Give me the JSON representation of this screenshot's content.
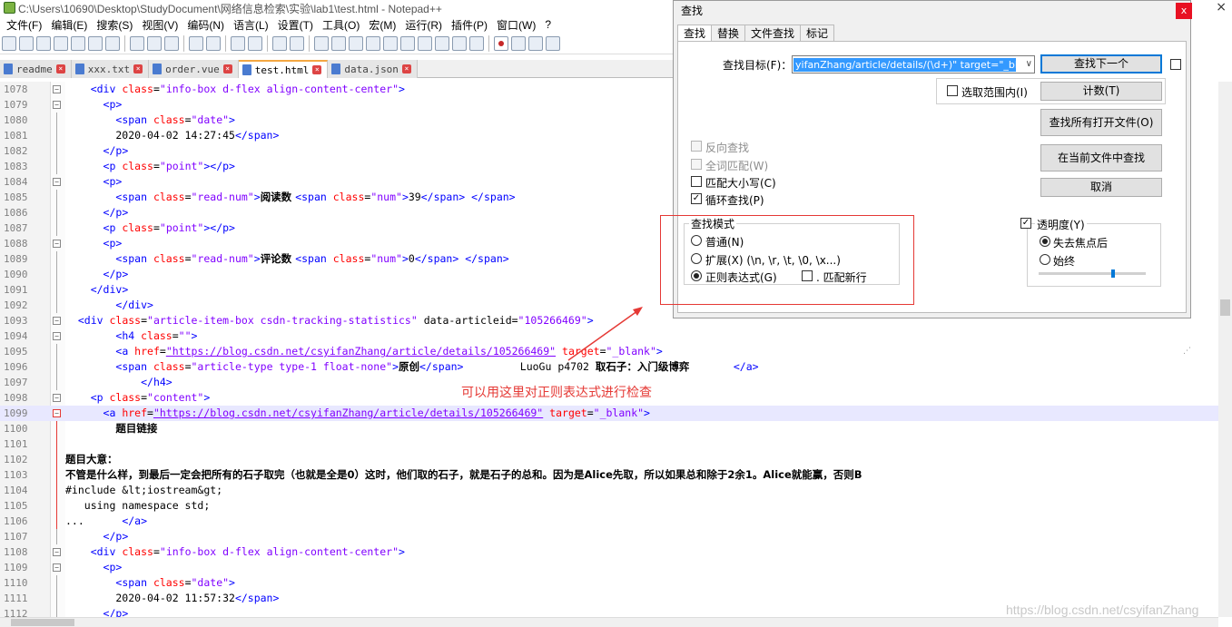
{
  "window": {
    "title": "C:\\Users\\10690\\Desktop\\StudyDocument\\网络信息检索\\实验\\lab1\\test.html - Notepad++",
    "close_glyph": "×"
  },
  "menu": [
    "文件(F)",
    "编辑(E)",
    "搜索(S)",
    "视图(V)",
    "编码(N)",
    "语言(L)",
    "设置(T)",
    "工具(O)",
    "宏(M)",
    "运行(R)",
    "插件(P)",
    "窗口(W)",
    "?"
  ],
  "tabs": [
    {
      "label": "readme",
      "active": false
    },
    {
      "label": "xxx.txt",
      "active": false
    },
    {
      "label": "order.vue",
      "active": false
    },
    {
      "label": "test.html",
      "active": true
    },
    {
      "label": "data.json",
      "active": false
    }
  ],
  "tab_close_glyph": "×",
  "editor": {
    "lines": [
      {
        "n": "1078",
        "fold": "minus",
        "segs": [
          [
            "p",
            "    "
          ],
          [
            "t",
            "<div "
          ],
          [
            "a",
            "class"
          ],
          [
            "p",
            "="
          ],
          [
            "v",
            "\"info-box d-flex align-content-center\""
          ],
          [
            "t",
            ">"
          ]
        ]
      },
      {
        "n": "1079",
        "fold": "minus",
        "segs": [
          [
            "p",
            "      "
          ],
          [
            "t",
            "<p>"
          ]
        ]
      },
      {
        "n": "1080",
        "fold": "line",
        "segs": [
          [
            "p",
            "        "
          ],
          [
            "t",
            "<span "
          ],
          [
            "a",
            "class"
          ],
          [
            "p",
            "="
          ],
          [
            "v",
            "\"date\""
          ],
          [
            "t",
            ">"
          ]
        ]
      },
      {
        "n": "1081",
        "fold": "line",
        "segs": [
          [
            "p",
            "        2020-04-02 14:27:45"
          ],
          [
            "t",
            "</span>"
          ]
        ]
      },
      {
        "n": "1082",
        "fold": "line",
        "segs": [
          [
            "p",
            "      "
          ],
          [
            "t",
            "</p>"
          ]
        ]
      },
      {
        "n": "1083",
        "fold": "line",
        "segs": [
          [
            "p",
            "      "
          ],
          [
            "t",
            "<p "
          ],
          [
            "a",
            "class"
          ],
          [
            "p",
            "="
          ],
          [
            "v",
            "\"point\""
          ],
          [
            "t",
            "></p>"
          ]
        ]
      },
      {
        "n": "1084",
        "fold": "minus",
        "segs": [
          [
            "p",
            "      "
          ],
          [
            "t",
            "<p>"
          ]
        ]
      },
      {
        "n": "1085",
        "fold": "line",
        "segs": [
          [
            "p",
            "        "
          ],
          [
            "t",
            "<span "
          ],
          [
            "a",
            "class"
          ],
          [
            "p",
            "="
          ],
          [
            "v",
            "\"read-num\""
          ],
          [
            "t",
            ">"
          ],
          [
            "c",
            "阅读数 "
          ],
          [
            "t",
            "<span "
          ],
          [
            "a",
            "class"
          ],
          [
            "p",
            "="
          ],
          [
            "v",
            "\"num\""
          ],
          [
            "t",
            ">"
          ],
          [
            "p",
            "39"
          ],
          [
            "t",
            "</span> </span>"
          ]
        ]
      },
      {
        "n": "1086",
        "fold": "line",
        "segs": [
          [
            "p",
            "      "
          ],
          [
            "t",
            "</p>"
          ]
        ]
      },
      {
        "n": "1087",
        "fold": "line",
        "segs": [
          [
            "p",
            "      "
          ],
          [
            "t",
            "<p "
          ],
          [
            "a",
            "class"
          ],
          [
            "p",
            "="
          ],
          [
            "v",
            "\"point\""
          ],
          [
            "t",
            "></p>"
          ]
        ]
      },
      {
        "n": "1088",
        "fold": "minus",
        "segs": [
          [
            "p",
            "      "
          ],
          [
            "t",
            "<p>"
          ]
        ]
      },
      {
        "n": "1089",
        "fold": "line",
        "segs": [
          [
            "p",
            "        "
          ],
          [
            "t",
            "<span "
          ],
          [
            "a",
            "class"
          ],
          [
            "p",
            "="
          ],
          [
            "v",
            "\"read-num\""
          ],
          [
            "t",
            ">"
          ],
          [
            "c",
            "评论数 "
          ],
          [
            "t",
            "<span "
          ],
          [
            "a",
            "class"
          ],
          [
            "p",
            "="
          ],
          [
            "v",
            "\"num\""
          ],
          [
            "t",
            ">"
          ],
          [
            "p",
            "0"
          ],
          [
            "t",
            "</span> </span>"
          ]
        ]
      },
      {
        "n": "1090",
        "fold": "line",
        "segs": [
          [
            "p",
            "      "
          ],
          [
            "t",
            "</p>"
          ]
        ]
      },
      {
        "n": "1091",
        "fold": "line",
        "segs": [
          [
            "p",
            "    "
          ],
          [
            "t",
            "</div>"
          ]
        ]
      },
      {
        "n": "1092",
        "fold": "line",
        "segs": [
          [
            "p",
            "        "
          ],
          [
            "t",
            "</div>"
          ]
        ]
      },
      {
        "n": "1093",
        "fold": "minus",
        "segs": [
          [
            "p",
            "  "
          ],
          [
            "t",
            "<div "
          ],
          [
            "a",
            "class"
          ],
          [
            "p",
            "="
          ],
          [
            "v",
            "\"article-item-box csdn-tracking-statistics\""
          ],
          [
            "p",
            " data-articleid="
          ],
          [
            "v",
            "\"105266469\""
          ],
          [
            "t",
            ">"
          ]
        ]
      },
      {
        "n": "1094",
        "fold": "minus",
        "segs": [
          [
            "p",
            "        "
          ],
          [
            "t",
            "<h4 "
          ],
          [
            "a",
            "class"
          ],
          [
            "p",
            "="
          ],
          [
            "v",
            "\"\""
          ],
          [
            "t",
            ">"
          ]
        ]
      },
      {
        "n": "1095",
        "fold": "line",
        "segs": [
          [
            "p",
            "        "
          ],
          [
            "t",
            "<a "
          ],
          [
            "a",
            "href"
          ],
          [
            "p",
            "="
          ],
          [
            "u",
            "\"https://blog.csdn.net/csyifanZhang/article/details/105266469\""
          ],
          [
            "p",
            " "
          ],
          [
            "a",
            "target"
          ],
          [
            "p",
            "="
          ],
          [
            "v",
            "\"_blank\""
          ],
          [
            "t",
            ">"
          ]
        ]
      },
      {
        "n": "1096",
        "fold": "line",
        "segs": [
          [
            "p",
            "        "
          ],
          [
            "t",
            "<span "
          ],
          [
            "a",
            "class"
          ],
          [
            "p",
            "="
          ],
          [
            "v",
            "\"article-type type-1 float-none\""
          ],
          [
            "t",
            ">"
          ],
          [
            "c",
            "原创"
          ],
          [
            "t",
            "</span>"
          ],
          [
            "p",
            "         LuoGu p4702 "
          ],
          [
            "c",
            "取石子：入门级博弈"
          ],
          [
            "p",
            "       "
          ],
          [
            "t",
            "</a>"
          ]
        ]
      },
      {
        "n": "1097",
        "fold": "line",
        "segs": [
          [
            "p",
            "            "
          ],
          [
            "t",
            "</h4>"
          ]
        ]
      },
      {
        "n": "1098",
        "fold": "minus",
        "segs": [
          [
            "p",
            "    "
          ],
          [
            "t",
            "<p "
          ],
          [
            "a",
            "class"
          ],
          [
            "p",
            "="
          ],
          [
            "v",
            "\"content\""
          ],
          [
            "t",
            ">"
          ]
        ]
      },
      {
        "n": "1099",
        "fold": "redminus",
        "hl": true,
        "segs": [
          [
            "p",
            "      "
          ],
          [
            "t",
            "<a "
          ],
          [
            "a",
            "href"
          ],
          [
            "p",
            "="
          ],
          [
            "u",
            "\"https://blog.csdn.net/csyifanZhang/article/details/105266469\""
          ],
          [
            "p",
            " "
          ],
          [
            "a",
            "target"
          ],
          [
            "p",
            "="
          ],
          [
            "v",
            "\"_blank\""
          ],
          [
            "t",
            ">"
          ]
        ]
      },
      {
        "n": "1100",
        "fold": "redline",
        "segs": [
          [
            "p",
            "        "
          ],
          [
            "c",
            "题目链接"
          ]
        ]
      },
      {
        "n": "1101",
        "fold": "redline",
        "segs": [
          [
            "p",
            ""
          ]
        ]
      },
      {
        "n": "1102",
        "fold": "redline",
        "segs": [
          [
            "c",
            "题目大意："
          ]
        ]
      },
      {
        "n": "1103",
        "fold": "redline",
        "segs": [
          [
            "c",
            "不管是什么样，到最后一定会把所有的石子取完（也就是全是0）这时，他们取的石子，就是石子的总和。因为是Alice先取，所以如果总和除于2余1。Alice就能赢，否则B"
          ]
        ]
      },
      {
        "n": "1104",
        "fold": "redline",
        "segs": [
          [
            "p",
            "#include &lt;iostream&gt;"
          ]
        ]
      },
      {
        "n": "1105",
        "fold": "redline",
        "segs": [
          [
            "p",
            "   using namespace std;"
          ]
        ]
      },
      {
        "n": "1106",
        "fold": "redend",
        "segs": [
          [
            "p",
            "...      "
          ],
          [
            "t",
            "</a>"
          ]
        ]
      },
      {
        "n": "1107",
        "fold": "line",
        "segs": [
          [
            "p",
            "      "
          ],
          [
            "t",
            "</p>"
          ]
        ]
      },
      {
        "n": "1108",
        "fold": "minus",
        "segs": [
          [
            "p",
            "    "
          ],
          [
            "t",
            "<div "
          ],
          [
            "a",
            "class"
          ],
          [
            "p",
            "="
          ],
          [
            "v",
            "\"info-box d-flex align-content-center\""
          ],
          [
            "t",
            ">"
          ]
        ]
      },
      {
        "n": "1109",
        "fold": "minus",
        "segs": [
          [
            "p",
            "      "
          ],
          [
            "t",
            "<p>"
          ]
        ]
      },
      {
        "n": "1110",
        "fold": "line",
        "segs": [
          [
            "p",
            "        "
          ],
          [
            "t",
            "<span "
          ],
          [
            "a",
            "class"
          ],
          [
            "p",
            "="
          ],
          [
            "v",
            "\"date\""
          ],
          [
            "t",
            ">"
          ]
        ]
      },
      {
        "n": "1111",
        "fold": "line",
        "segs": [
          [
            "p",
            "        2020-04-02 11:57:32"
          ],
          [
            "t",
            "</span>"
          ]
        ]
      },
      {
        "n": "1112",
        "fold": "line",
        "segs": [
          [
            "p",
            "      "
          ],
          [
            "t",
            "</p>"
          ]
        ]
      }
    ]
  },
  "find_dialog": {
    "title": "查找",
    "close_glyph": "x",
    "tabs": [
      "查找",
      "替换",
      "文件查找",
      "标记"
    ],
    "active_tab": "查找",
    "find_label": "查找目标(F)：",
    "find_value": "yifanZhang/article/details/(\\d+)\" target=\"_blank\">",
    "dropdown_glyph": "∨",
    "buttons": {
      "find_next": "查找下一个",
      "count": "计数(T)",
      "find_all_open": "查找所有打开文件(O)",
      "find_all_current": "在当前文件中查找",
      "cancel": "取消"
    },
    "in_selection": "选取范围内(I)",
    "options": {
      "backward": "反向查找",
      "whole_word": "全词匹配(W)",
      "match_case": "匹配大小写(C)",
      "wrap": "循环查找(P)"
    },
    "check_glyph": "✓",
    "search_mode": {
      "title": "查找模式",
      "normal": "普通(N)",
      "extended": "扩展(X) (\\n, \\r, \\t, \\0, \\x...)",
      "regex": "正则表达式(G)",
      "dot_newline": ". 匹配新行",
      "selected": "regex"
    },
    "transparency": {
      "label": "透明度(Y)",
      "on_lose_focus": "失去焦点后",
      "always": "始终",
      "enabled": true,
      "level": 0.7
    }
  },
  "annotation": "可以用这里对正则表达式进行检查",
  "watermark": "https://blog.csdn.net/csyifanZhang",
  "colors": {
    "tag": "#0000ff",
    "attribute": "#ff0000",
    "value": "#8000ff",
    "annotation": "#e53935",
    "selection": "#3399ff"
  }
}
